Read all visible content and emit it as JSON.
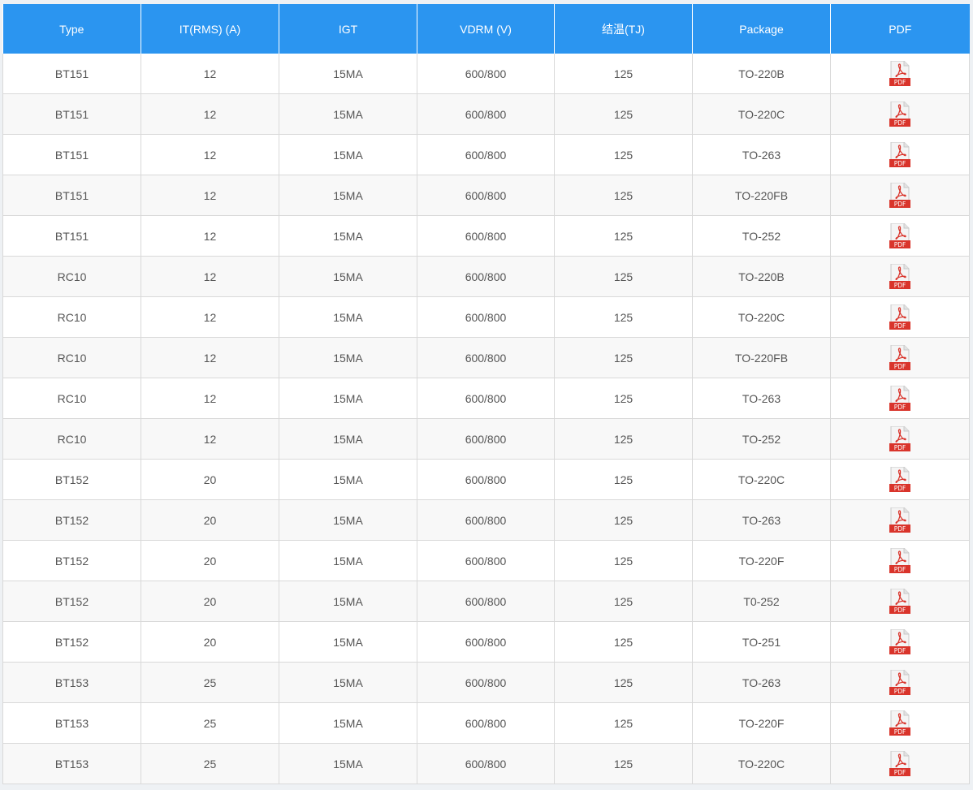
{
  "table": {
    "headers": [
      "Type",
      "IT(RMS) (A)",
      "IGT",
      "VDRM (V)",
      "结温(TJ)",
      "Package",
      "PDF"
    ],
    "pdf_icon_label": "PDF",
    "colors": {
      "header_bg": "#2b95f0",
      "header_text": "#ffffff",
      "row_alt_bg": "#f8f8f8",
      "pdf_red": "#d9342b"
    },
    "rows": [
      [
        "BT151",
        "12",
        "15MA",
        "600/800",
        "125",
        "TO-220B"
      ],
      [
        "BT151",
        "12",
        "15MA",
        "600/800",
        "125",
        "TO-220C"
      ],
      [
        "BT151",
        "12",
        "15MA",
        "600/800",
        "125",
        "TO-263"
      ],
      [
        "BT151",
        "12",
        "15MA",
        "600/800",
        "125",
        "TO-220FB"
      ],
      [
        "BT151",
        "12",
        "15MA",
        "600/800",
        "125",
        "TO-252"
      ],
      [
        "RC10",
        "12",
        "15MA",
        "600/800",
        "125",
        "TO-220B"
      ],
      [
        "RC10",
        "12",
        "15MA",
        "600/800",
        "125",
        "TO-220C"
      ],
      [
        "RC10",
        "12",
        "15MA",
        "600/800",
        "125",
        "TO-220FB"
      ],
      [
        "RC10",
        "12",
        "15MA",
        "600/800",
        "125",
        "TO-263"
      ],
      [
        "RC10",
        "12",
        "15MA",
        "600/800",
        "125",
        "TO-252"
      ],
      [
        "BT152",
        "20",
        "15MA",
        "600/800",
        "125",
        "TO-220C"
      ],
      [
        "BT152",
        "20",
        "15MA",
        "600/800",
        "125",
        "TO-263"
      ],
      [
        "BT152",
        "20",
        "15MA",
        "600/800",
        "125",
        "TO-220F"
      ],
      [
        "BT152",
        "20",
        "15MA",
        "600/800",
        "125",
        "T0-252"
      ],
      [
        "BT152",
        "20",
        "15MA",
        "600/800",
        "125",
        "TO-251"
      ],
      [
        "BT153",
        "25",
        "15MA",
        "600/800",
        "125",
        "TO-263"
      ],
      [
        "BT153",
        "25",
        "15MA",
        "600/800",
        "125",
        "TO-220F"
      ],
      [
        "BT153",
        "25",
        "15MA",
        "600/800",
        "125",
        "TO-220C"
      ]
    ]
  }
}
